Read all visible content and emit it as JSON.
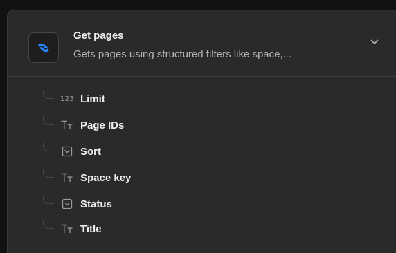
{
  "node": {
    "title": "Get pages",
    "description": "Gets pages using structured filters like space,...",
    "app_icon": "confluence-icon",
    "accent_color": "#2684ff"
  },
  "fields": [
    {
      "label": "Limit",
      "icon": "number-type-icon",
      "icon_text": "123"
    },
    {
      "label": "Page IDs",
      "icon": "text-type-icon"
    },
    {
      "label": "Sort",
      "icon": "select-type-icon"
    },
    {
      "label": "Space key",
      "icon": "text-type-icon"
    },
    {
      "label": "Status",
      "icon": "select-type-icon"
    },
    {
      "label": "Title",
      "icon": "text-type-icon"
    }
  ]
}
